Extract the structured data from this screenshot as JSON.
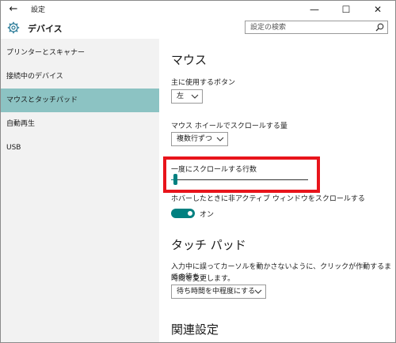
{
  "titlebar": {
    "title": "設定",
    "back_symbol": "←",
    "minimize_symbol": "—",
    "maximize_symbol": "☐",
    "close_symbol": "✕"
  },
  "header": {
    "title": "デバイス",
    "search_placeholder": "設定の検索"
  },
  "sidebar": {
    "items": [
      {
        "label": "プリンターとスキャナー"
      },
      {
        "label": "接続中のデバイス"
      },
      {
        "label": "マウスとタッチパッド",
        "selected": true
      },
      {
        "label": "自動再生"
      },
      {
        "label": "USB"
      }
    ]
  },
  "main": {
    "mouse_heading": "マウス",
    "primary_button_label": "主に使用するボタン",
    "primary_button_value": "左",
    "wheel_label": "マウス ホイールでスクロールする量",
    "wheel_value": "複数行ずつ",
    "lines_label": "一度にスクロールする行数",
    "lines_slider_fraction": 0.02,
    "inactive_scroll_label": "ホバーしたときに非アクティブ ウィンドウをスクロールする",
    "inactive_scroll_state": "オン",
    "touchpad_heading": "タッチ パッド",
    "touchpad_desc_line1": "入力中に誤ってカーソルを動かさないように、クリックが作動するまでの待ち",
    "touchpad_desc_line2": "時間を変更します。",
    "delay_value": "待ち時間を中程度にする",
    "related_heading": "関連設定"
  },
  "colors": {
    "accent": "#008080",
    "selected_nav": "#8cc3c3",
    "highlight_box": "#e8141b"
  }
}
